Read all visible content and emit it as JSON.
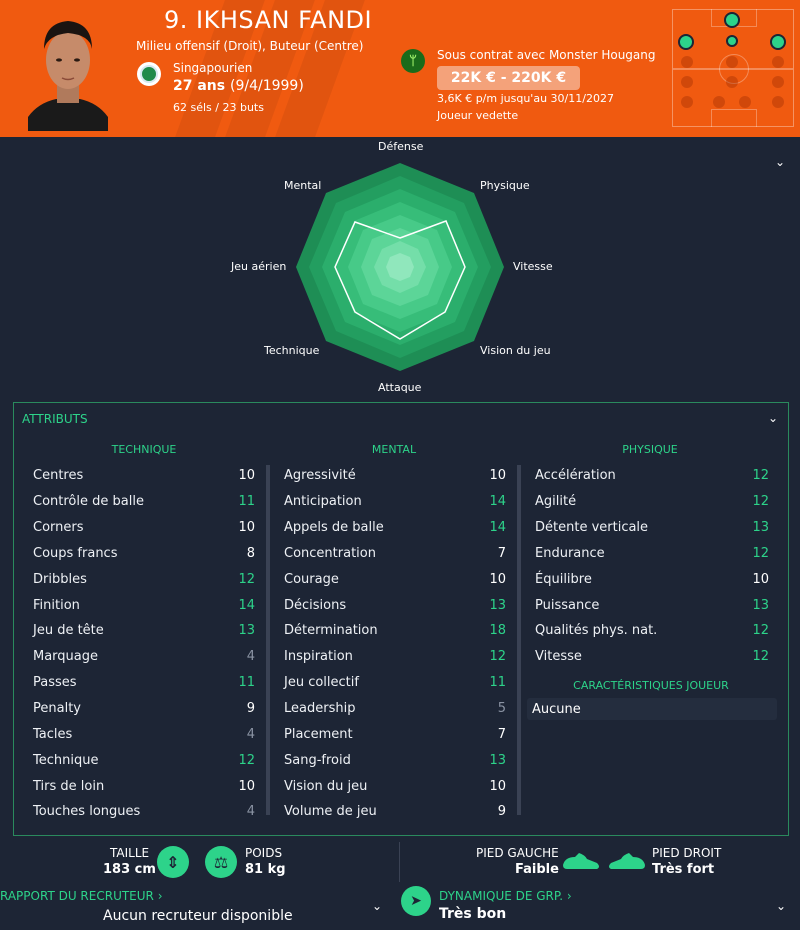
{
  "header": {
    "name": "9. IKHSAN FANDI",
    "role": "Milieu offensif (Droit), Buteur (Centre)",
    "nationality": "Singapourien",
    "age": "27 ans",
    "dob": "(9/4/1999)",
    "caps": "62 séls / 23 buts",
    "contract": "Sous contrat avec Monster Hougang",
    "wage": "22K € - 220K €",
    "wage_detail": "3,6K € p/m jusqu'au 30/11/2027",
    "status": "Joueur vedette",
    "colors": {
      "header_bg": "#f05a10",
      "accent": "#2dd38a"
    }
  },
  "radar": {
    "labels": [
      "Défense",
      "Physique",
      "Vitesse",
      "Vision du jeu",
      "Attaque",
      "Technique",
      "Jeu aérien",
      "Mental"
    ]
  },
  "attributes": {
    "title": "ATTRIBUTS",
    "columns": [
      {
        "heading": "TECHNIQUE",
        "items": [
          {
            "label": "Centres",
            "value": "10",
            "tone": "w"
          },
          {
            "label": "Contrôle de balle",
            "value": "11",
            "tone": "g"
          },
          {
            "label": "Corners",
            "value": "10",
            "tone": "w"
          },
          {
            "label": "Coups francs",
            "value": "8",
            "tone": "w"
          },
          {
            "label": "Dribbles",
            "value": "12",
            "tone": "g"
          },
          {
            "label": "Finition",
            "value": "14",
            "tone": "g"
          },
          {
            "label": "Jeu de tête",
            "value": "13",
            "tone": "g"
          },
          {
            "label": "Marquage",
            "value": "4",
            "tone": "d"
          },
          {
            "label": "Passes",
            "value": "11",
            "tone": "g"
          },
          {
            "label": "Penalty",
            "value": "9",
            "tone": "w"
          },
          {
            "label": "Tacles",
            "value": "4",
            "tone": "d"
          },
          {
            "label": "Technique",
            "value": "12",
            "tone": "g"
          },
          {
            "label": "Tirs de loin",
            "value": "10",
            "tone": "w"
          },
          {
            "label": "Touches longues",
            "value": "4",
            "tone": "d"
          }
        ]
      },
      {
        "heading": "MENTAL",
        "items": [
          {
            "label": "Agressivité",
            "value": "10",
            "tone": "w"
          },
          {
            "label": "Anticipation",
            "value": "14",
            "tone": "g"
          },
          {
            "label": "Appels de balle",
            "value": "14",
            "tone": "g"
          },
          {
            "label": "Concentration",
            "value": "7",
            "tone": "w"
          },
          {
            "label": "Courage",
            "value": "10",
            "tone": "w"
          },
          {
            "label": "Décisions",
            "value": "13",
            "tone": "g"
          },
          {
            "label": "Détermination",
            "value": "18",
            "tone": "g"
          },
          {
            "label": "Inspiration",
            "value": "12",
            "tone": "g"
          },
          {
            "label": "Jeu collectif",
            "value": "11",
            "tone": "g"
          },
          {
            "label": "Leadership",
            "value": "5",
            "tone": "d"
          },
          {
            "label": "Placement",
            "value": "7",
            "tone": "w"
          },
          {
            "label": "Sang-froid",
            "value": "13",
            "tone": "g"
          },
          {
            "label": "Vision du jeu",
            "value": "10",
            "tone": "w"
          },
          {
            "label": "Volume de jeu",
            "value": "9",
            "tone": "w"
          }
        ]
      },
      {
        "heading": "PHYSIQUE",
        "items": [
          {
            "label": "Accélération",
            "value": "12",
            "tone": "g"
          },
          {
            "label": "Agilité",
            "value": "12",
            "tone": "g"
          },
          {
            "label": "Détente verticale",
            "value": "13",
            "tone": "g"
          },
          {
            "label": "Endurance",
            "value": "12",
            "tone": "g"
          },
          {
            "label": "Équilibre",
            "value": "10",
            "tone": "w"
          },
          {
            "label": "Puissance",
            "value": "13",
            "tone": "g"
          },
          {
            "label": "Qualités phys. nat.",
            "value": "12",
            "tone": "g"
          },
          {
            "label": "Vitesse",
            "value": "12",
            "tone": "g"
          }
        ]
      }
    ],
    "characteristics_heading": "CARACTÉRISTIQUES JOUEUR",
    "characteristics_value": "Aucune"
  },
  "footer": {
    "height_label": "TAILLE",
    "height_value": "183 cm",
    "weight_label": "POIDS",
    "weight_value": "81 kg",
    "left_foot_label": "PIED GAUCHE",
    "left_foot_value": "Faible",
    "right_foot_label": "PIED DROIT",
    "right_foot_value": "Très fort",
    "scout_label": "RAPPORT DU RECRUTEUR ›",
    "scout_value": "Aucun recruteur disponible",
    "dynamics_label": "DYNAMIQUE DE GRP. ›",
    "dynamics_value": "Très bon"
  }
}
